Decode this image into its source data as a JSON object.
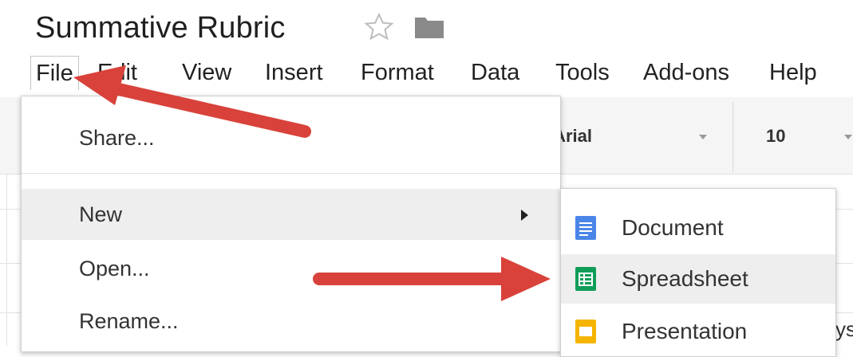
{
  "doc": {
    "title": "Summative Rubric"
  },
  "menubar": {
    "items": [
      "File",
      "Edit",
      "View",
      "Insert",
      "Format",
      "Data",
      "Tools",
      "Add-ons",
      "Help"
    ]
  },
  "toolbar": {
    "font_name": "Arial",
    "font_size": "10"
  },
  "file_menu": {
    "share": "Share...",
    "new": "New",
    "open": "Open...",
    "rename": "Rename..."
  },
  "new_submenu": {
    "document": "Document",
    "spreadsheet": "Spreadsheet",
    "presentation": "Presentation"
  },
  "partial_text": "ys",
  "colors": {
    "arrow": "#d8423a",
    "doc_icon": "#4a86e8",
    "sheet_icon": "#0f9d58",
    "slides_icon": "#f4b400"
  }
}
